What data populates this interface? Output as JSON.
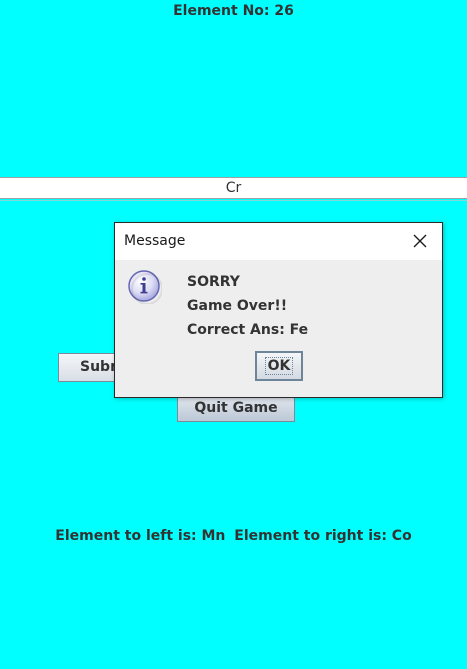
{
  "game": {
    "element_no": "Element No: 26",
    "answer_value": "Cr",
    "submit_label": "Submit",
    "quit_label": "Quit Game",
    "left_neighbor": "Element to left is: Mn",
    "right_neighbor": "Element to right is: Co"
  },
  "dialog": {
    "title": "Message",
    "icon": "info-icon",
    "line1": "SORRY",
    "line2": "Game Over!!",
    "line3": "Correct Ans: Fe",
    "ok_label": "OK"
  },
  "colors": {
    "background": "#00FFFF",
    "dialog_background": "#EEEEEE",
    "text": "#333333"
  }
}
